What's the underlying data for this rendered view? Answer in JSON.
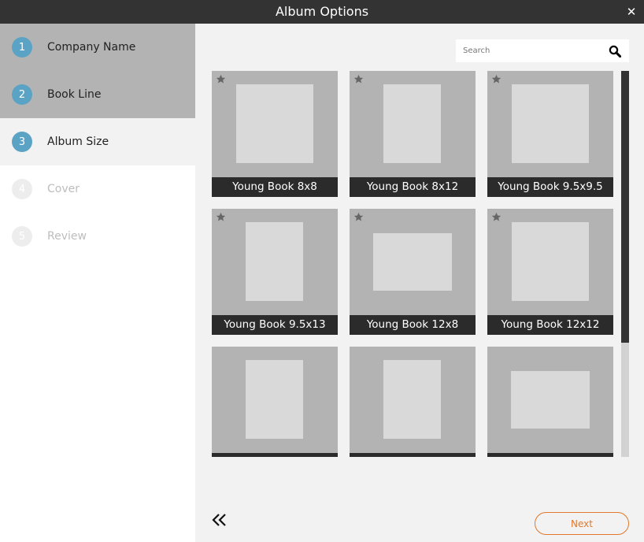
{
  "window": {
    "title": "Album Options",
    "close_icon": "close-icon"
  },
  "steps": [
    {
      "number": "1",
      "label": "Company Name",
      "state": "done"
    },
    {
      "number": "2",
      "label": "Book Line",
      "state": "done"
    },
    {
      "number": "3",
      "label": "Album Size",
      "state": "active"
    },
    {
      "number": "4",
      "label": "Cover",
      "state": "todo"
    },
    {
      "number": "5",
      "label": "Review",
      "state": "todo"
    }
  ],
  "search": {
    "placeholder": "Search",
    "value": "",
    "icon": "search-icon"
  },
  "albums": [
    {
      "name": "Young Book 8x8",
      "favorite": true
    },
    {
      "name": "Young Book 8x12",
      "favorite": true
    },
    {
      "name": "Young Book 9.5x9.5",
      "favorite": true
    },
    {
      "name": "Young Book 9.5x13",
      "favorite": true
    },
    {
      "name": "Young Book 12x8",
      "favorite": true
    },
    {
      "name": "Young Book 12x12",
      "favorite": true
    },
    {
      "name": "",
      "favorite": false
    },
    {
      "name": "",
      "favorite": false
    },
    {
      "name": "",
      "favorite": false
    }
  ],
  "footer": {
    "back_icon": "double-chevron-left-icon",
    "next_label": "Next"
  },
  "colors": {
    "titlebar": "#333333",
    "step_number": "#5ba3c4",
    "next_accent": "#e0782e",
    "tile": "#b3b3b3"
  }
}
